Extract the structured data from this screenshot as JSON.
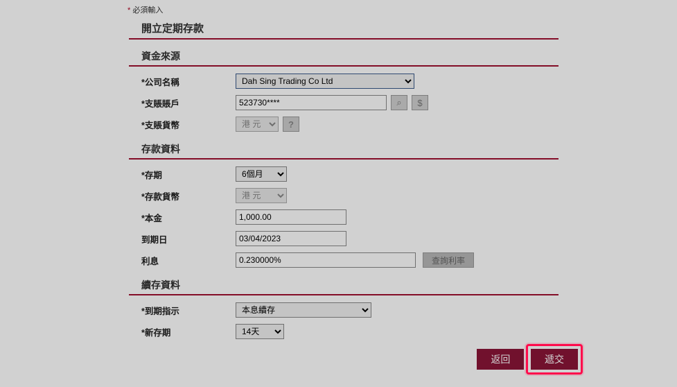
{
  "required_note": "必須輸入",
  "page_title": "開立定期存款",
  "sections": {
    "source": {
      "header": "資金來源",
      "company_label": "*公司名稱",
      "company_value": "Dah Sing Trading Co Ltd",
      "account_label": "*支賬賬戶",
      "account_value": "523730****",
      "currency_label": "*支賬貨幣",
      "currency_value": "港 元"
    },
    "deposit": {
      "header": "存款資料",
      "tenor_label": "*存期",
      "tenor_value": "6個月",
      "currency_label": "*存款貨幣",
      "currency_value": "港 元",
      "principal_label": "*本金",
      "principal_value": "1,000.00",
      "maturity_label": "到期日",
      "maturity_value": "03/04/2023",
      "rate_label": "利息",
      "rate_value": "0.230000%",
      "rate_query_btn": "查詢利率"
    },
    "renewal": {
      "header": "續存資料",
      "instruction_label": "*到期指示",
      "instruction_value": "本息續存",
      "new_tenor_label": "*新存期",
      "new_tenor_value": "14天"
    }
  },
  "buttons": {
    "back": "返回",
    "submit": "遞交"
  },
  "icons": {
    "search": "⌕",
    "currency": "$",
    "help": "?"
  }
}
